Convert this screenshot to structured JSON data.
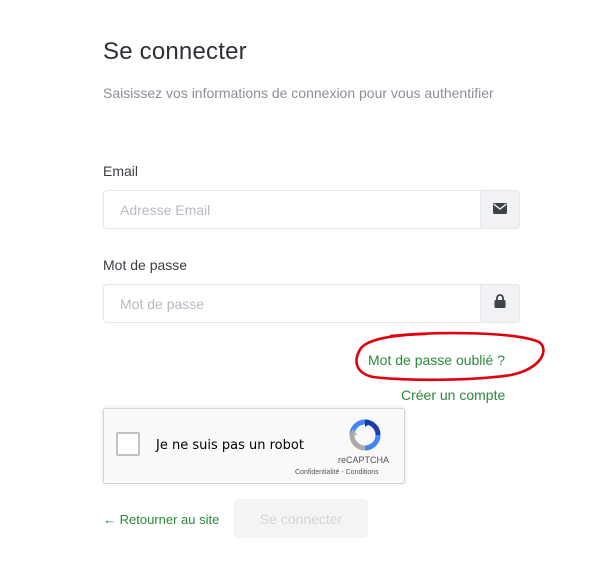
{
  "page": {
    "title": "Se connecter",
    "subtitle": "Saisissez vos informations de connexion pour vous authentifier"
  },
  "form": {
    "email": {
      "label": "Email",
      "placeholder": "Adresse Email",
      "value": "",
      "icon": "envelope-icon"
    },
    "password": {
      "label": "Mot de passe",
      "placeholder": "Mot de passe",
      "value": "",
      "icon": "lock-icon"
    },
    "forgot_password": "Mot de passe oublié ?",
    "create_account": "Créer un compte"
  },
  "recaptcha": {
    "label": "Je ne suis pas un robot",
    "brand": "reCAPTCHA",
    "privacy": "Confidentialité",
    "separator": " - ",
    "terms": "Conditions",
    "checked": false
  },
  "footer": {
    "back_arrow": "←",
    "back_label": "Retourner au site",
    "submit_label": "Se connecter"
  },
  "colors": {
    "link_green": "#2a8a3a",
    "annotation_red": "#e0000f",
    "submit_disabled_bg": "#f4f4f5"
  }
}
